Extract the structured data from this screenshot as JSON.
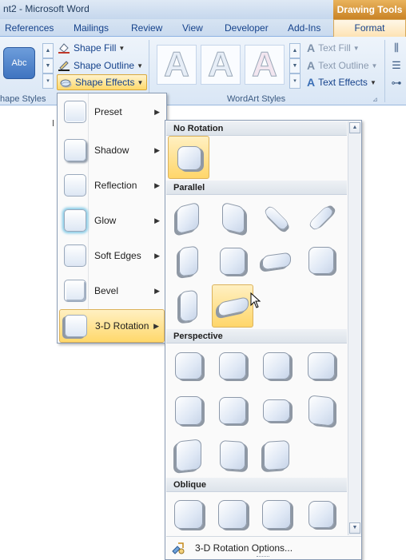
{
  "window": {
    "title": "nt2 - Microsoft Word",
    "context_tab_group": "Drawing Tools"
  },
  "tabs": [
    "References",
    "Mailings",
    "Review",
    "View",
    "Developer",
    "Add-Ins"
  ],
  "active_tab": "Format",
  "ribbon": {
    "shape_styles": {
      "swatch_text": "Abc",
      "shape_fill": "Shape Fill",
      "shape_outline": "Shape Outline",
      "shape_effects": "Shape Effects",
      "group_label": "hape Styles"
    },
    "wordart_styles": {
      "letter": "A",
      "text_fill": "Text Fill",
      "text_outline": "Text Outline",
      "text_effects": "Text Effects",
      "group_label": "WordArt Styles"
    }
  },
  "shape_effects_menu": {
    "items": [
      {
        "label": "Preset"
      },
      {
        "label": "Shadow"
      },
      {
        "label": "Reflection"
      },
      {
        "label": "Glow"
      },
      {
        "label": "Soft Edges"
      },
      {
        "label": "Bevel"
      },
      {
        "label": "3-D Rotation"
      }
    ],
    "selected": "3-D Rotation"
  },
  "rotation_submenu": {
    "sections": {
      "no_rotation": "No Rotation",
      "parallel": "Parallel",
      "perspective": "Perspective",
      "oblique": "Oblique"
    },
    "footer": "3-D Rotation Options..."
  },
  "colors": {
    "accent_orange": "#ffd86b",
    "ribbon_blue": "#15428b"
  }
}
